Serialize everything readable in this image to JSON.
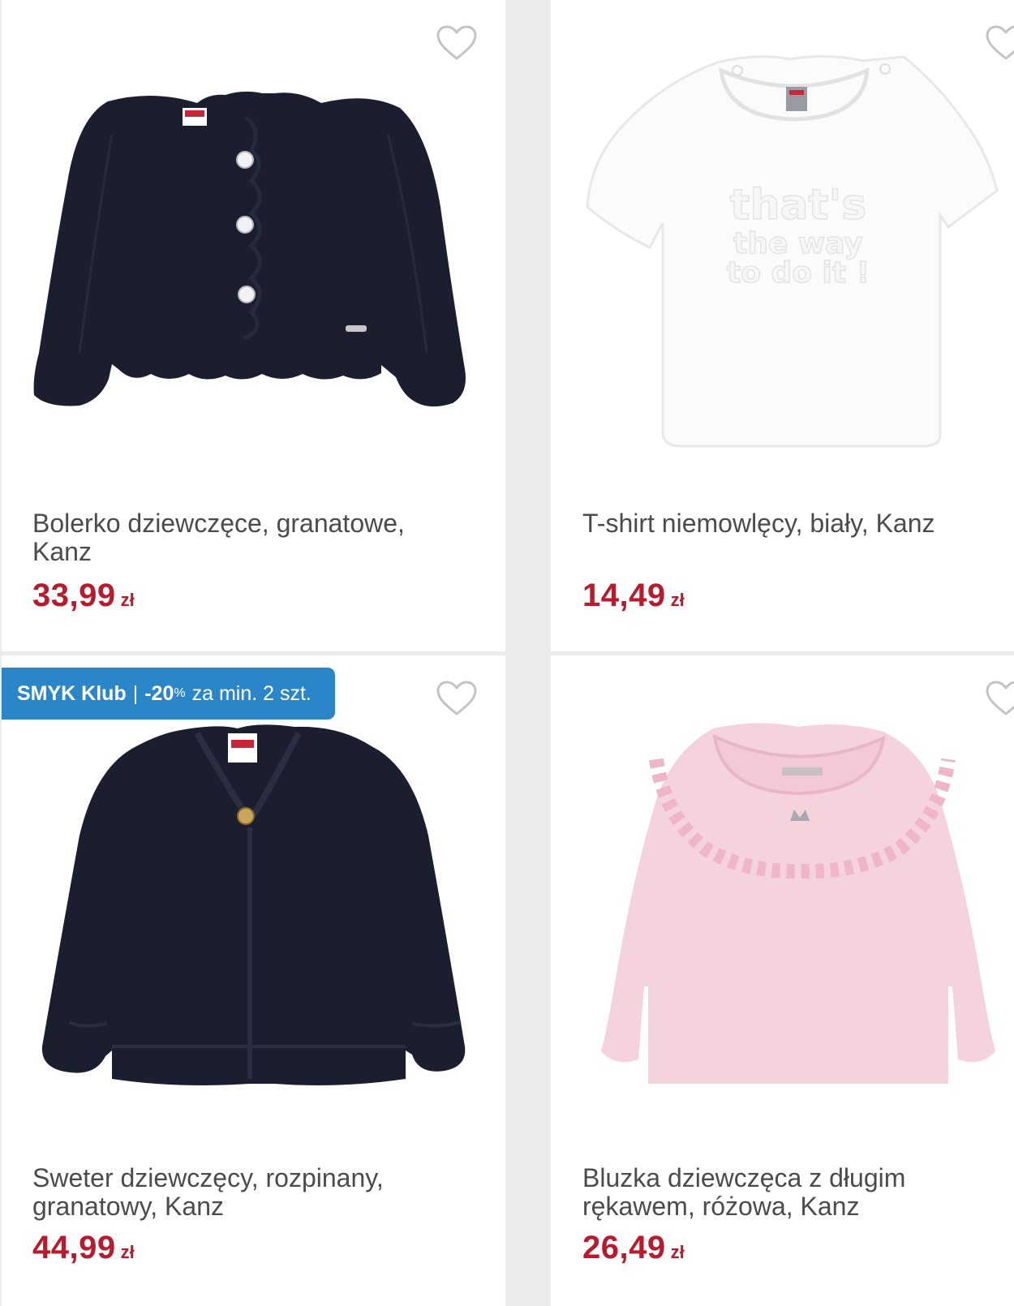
{
  "products": [
    {
      "title": "Bolerko dziewczęce, granatowe, Kanz",
      "price": "33,99",
      "currency": "zł",
      "image_icon": "navy-bolero-image",
      "favorite_icon": "heart-outline-icon"
    },
    {
      "title": "T-shirt niemowlęcy, biały, Kanz",
      "price": "14,49",
      "currency": "zł",
      "image_icon": "white-tshirt-image",
      "favorite_icon": "heart-outline-icon",
      "image_print": [
        "that's",
        "the way",
        "to do it !"
      ]
    },
    {
      "title": "Sweter dziewczęcy, rozpinany, granatowy, Kanz",
      "price": "44,99",
      "currency": "zł",
      "image_icon": "navy-cardigan-image",
      "favorite_icon": "heart-outline-icon",
      "badge": {
        "brand": "SMYK Klub",
        "separator": "|",
        "discount": "-20",
        "percent": "%",
        "condition": "za min. 2 szt."
      }
    },
    {
      "title": "Bluzka dziewczęca z długim rękawem, różowa, Kanz",
      "price": "26,49",
      "currency": "zł",
      "image_icon": "pink-ruffle-blouse-image",
      "favorite_icon": "heart-outline-icon"
    }
  ],
  "colors": {
    "price": "#b81b2e",
    "badge": "#2b86c7",
    "navy_garment": "#1b1e2e",
    "pink_garment": "#f5d3dd"
  }
}
